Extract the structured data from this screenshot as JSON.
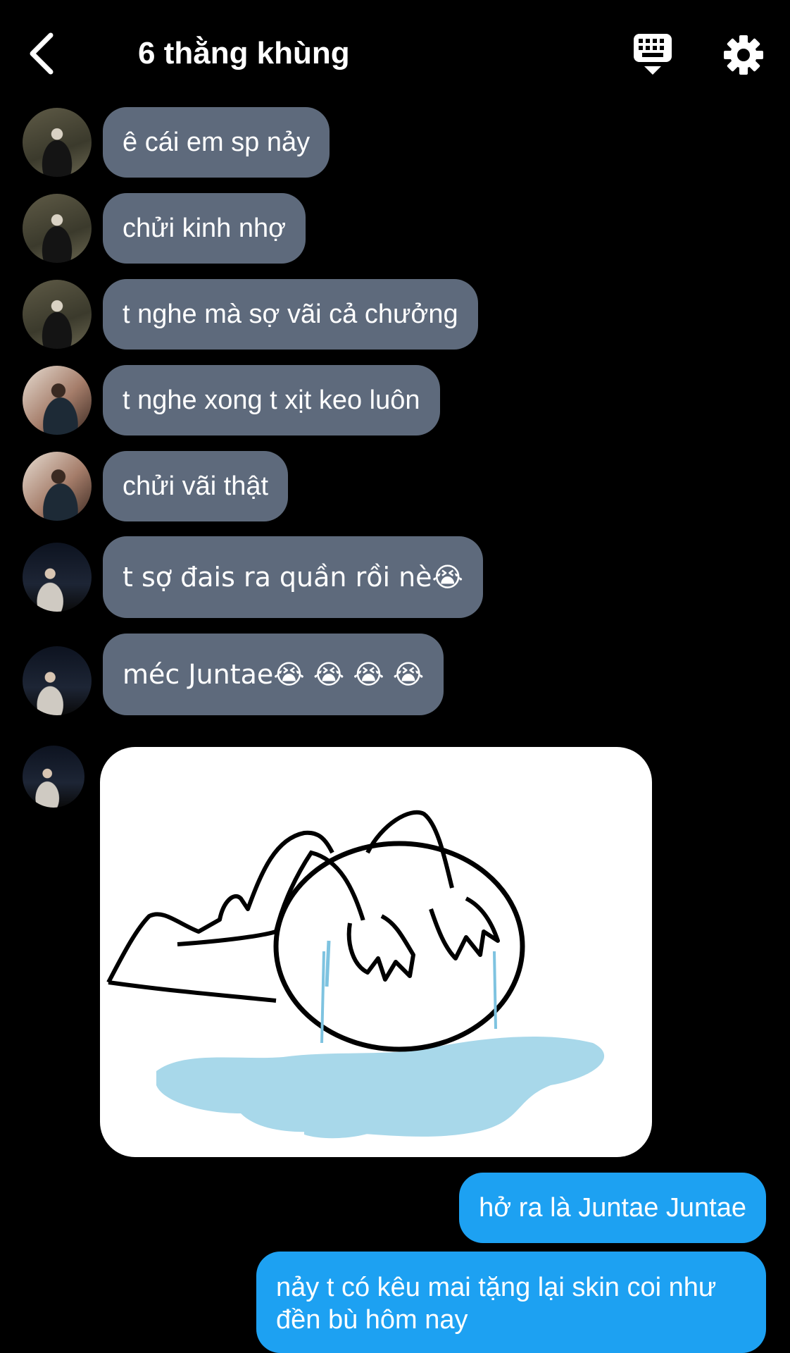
{
  "header": {
    "title": "6 thằng khùng",
    "back_icon": "chevron-left-icon",
    "keyboard_icon": "keyboard-icon",
    "settings_icon": "gear-icon"
  },
  "messages": [
    {
      "sender": "avatar-1",
      "text": "ê cái em sp nảy"
    },
    {
      "sender": "avatar-1",
      "text": "chửi kinh nhợ"
    },
    {
      "sender": "avatar-1",
      "text": "t nghe mà sợ vãi cả chưởng"
    },
    {
      "sender": "avatar-2",
      "text": "t nghe xong t xịt keo luôn"
    },
    {
      "sender": "avatar-2",
      "text": "chửi vãi thật"
    },
    {
      "sender": "avatar-3",
      "text": "t sợ đais ra quần rồi nè😭"
    },
    {
      "sender": "avatar-3",
      "text": "méc Juntae😭 😭 😭 😭"
    },
    {
      "sender": "avatar-3",
      "image": "crying-stick-figure-sticker"
    }
  ],
  "my_messages": [
    {
      "text": "hở ra là Juntae Juntae"
    },
    {
      "text": "nảy t có kêu mai tặng lại skin coi như đền bù hôm nay"
    }
  ],
  "colors": {
    "background": "#000000",
    "incoming_bubble": "#5e6a7c",
    "outgoing_bubble": "#1da1f2",
    "tear_blue": "#a8d8ea"
  }
}
